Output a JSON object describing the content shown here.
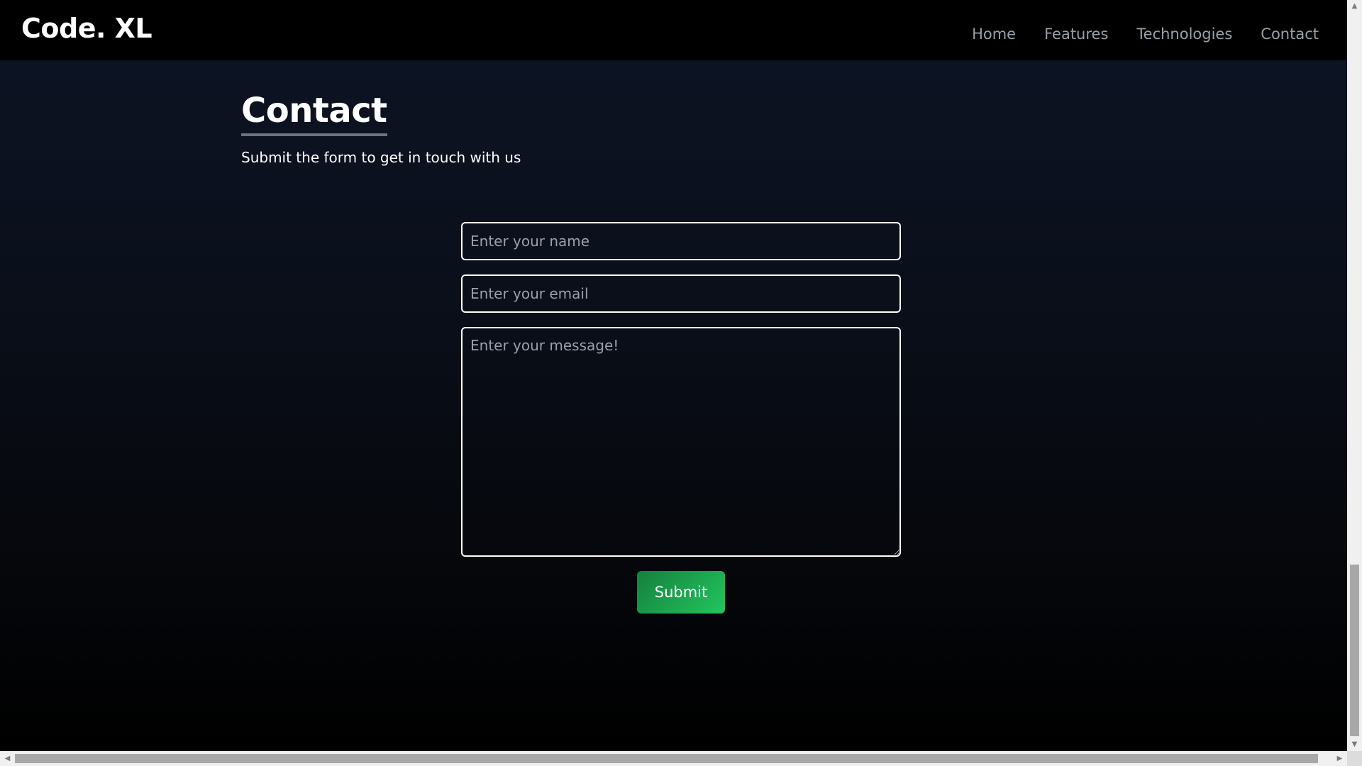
{
  "navbar": {
    "brand": "Code. XL",
    "links": [
      {
        "label": "Home"
      },
      {
        "label": "Features"
      },
      {
        "label": "Technologies"
      },
      {
        "label": "Contact"
      }
    ]
  },
  "contact": {
    "title": "Contact",
    "subtitle": "Submit the form to get in touch with us",
    "name_placeholder": "Enter your name",
    "email_placeholder": "Enter your email",
    "message_placeholder": "Enter your message!",
    "submit_label": "Submit"
  },
  "colors": {
    "accent": "#22c55e",
    "background_top": "#0d1424",
    "background_bottom": "#000000",
    "nav_link": "#9aa0a9"
  },
  "icons": {
    "scroll_up": "up-arrow-icon",
    "scroll_down": "down-arrow-icon",
    "scroll_left": "left-arrow-icon",
    "scroll_right": "right-arrow-icon"
  }
}
